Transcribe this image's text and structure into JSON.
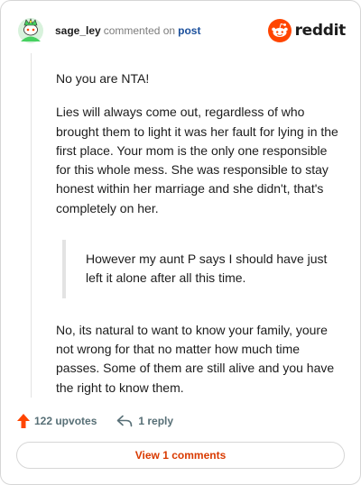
{
  "header": {
    "username": "sage_ley",
    "action": "commented on",
    "post_link": "post",
    "brand": "reddit"
  },
  "comment": {
    "paragraph_1": "No you are NTA!",
    "paragraph_2": "Lies will always come out, regardless of who brought them to light it was her fault for lying in the first place. Your mom is the only one responsible for this whole mess. She was responsible to stay honest within her marriage and she didn't, that's completely on her.",
    "quote": "However my aunt P says I should have just left it alone after all this time.",
    "paragraph_3": "No, its natural to want to know your family, youre not wrong for that no matter how much time passes. Some of them are still alive and you have the right to know them."
  },
  "footer": {
    "upvotes": "122 upvotes",
    "replies": "1 reply",
    "view_button": "View 1 comments"
  },
  "colors": {
    "brand_orange": "#ff4500",
    "link_blue": "#1a4f9c",
    "button_text": "#d93a00",
    "muted_text": "#576f76",
    "avatar_green": "#46d160"
  },
  "icons": {
    "avatar": "snoo-avatar-icon",
    "brand": "reddit-logo-icon",
    "upvote": "upvote-arrow-icon",
    "reply": "reply-arrow-icon"
  }
}
